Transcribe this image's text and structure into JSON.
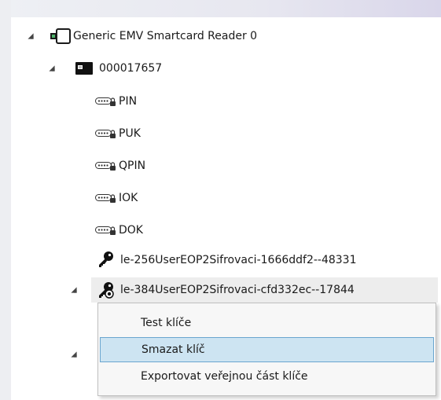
{
  "tree": {
    "reader": {
      "label": "Generic EMV Smartcard Reader 0",
      "icon": "card-reader-icon"
    },
    "card": {
      "label": "000017657",
      "icon": "smartcard-icon"
    },
    "objects": [
      {
        "label": "PIN",
        "icon": "pin-pad-icon"
      },
      {
        "label": "PUK",
        "icon": "pin-pad-icon"
      },
      {
        "label": "QPIN",
        "icon": "pin-pad-icon"
      },
      {
        "label": "IOK",
        "icon": "pin-pad-icon"
      },
      {
        "label": "DOK",
        "icon": "pin-pad-icon"
      }
    ],
    "keys": [
      {
        "label": "le-256UserEOP2Sifrovaci-1666ddf2--48331",
        "icon": "key-icon"
      },
      {
        "label": "le-384UserEOP2Sifrovaci-cfd332ec--17844",
        "icon": "key-with-certificate-icon"
      }
    ]
  },
  "context_menu": {
    "items": [
      {
        "label": "Test klíče"
      },
      {
        "label": "Smazat klíč"
      },
      {
        "label": "Exportovat veřejnou část klíče"
      }
    ]
  },
  "colors": {
    "menu_hot_fill": "#cde4f2",
    "menu_hot_border": "#6aa5cf",
    "selected_row": "#ededed"
  }
}
